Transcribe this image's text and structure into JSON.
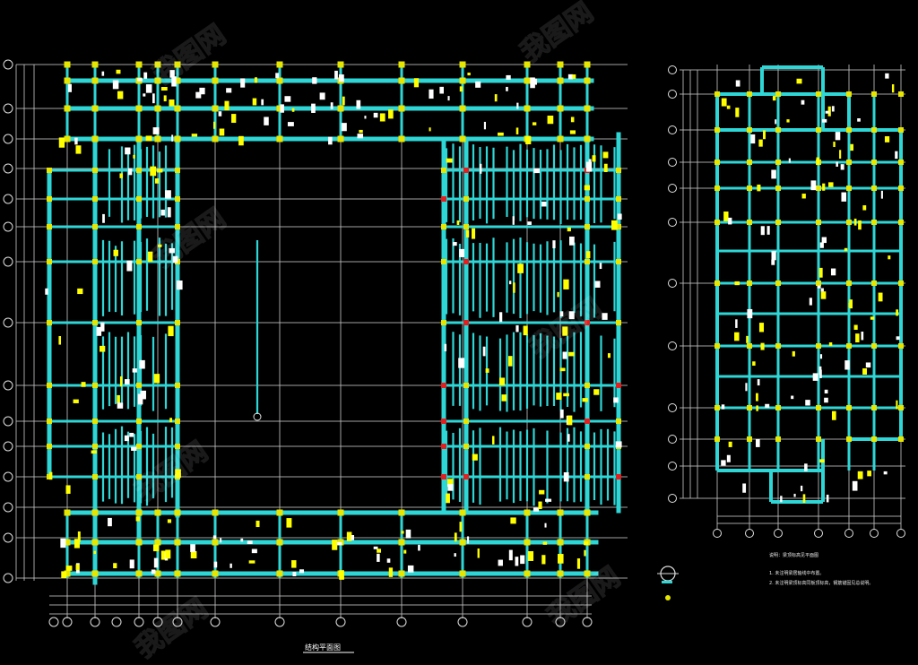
{
  "drawing": {
    "title": "结构平面图",
    "notes_heading": "说明：梁顶标高见平面图",
    "notes": [
      "1. 未注明梁居轴线中布置。",
      "2. 未注明梁顶标高同板顶标高，钢筋锚固见总说明。"
    ],
    "watermark": "我图网",
    "colors": {
      "background": "#000000",
      "grid": "#bfbfbf",
      "beam": "#2fd6d6",
      "column": "#e6e600",
      "annotation": "#ffff00"
    }
  }
}
